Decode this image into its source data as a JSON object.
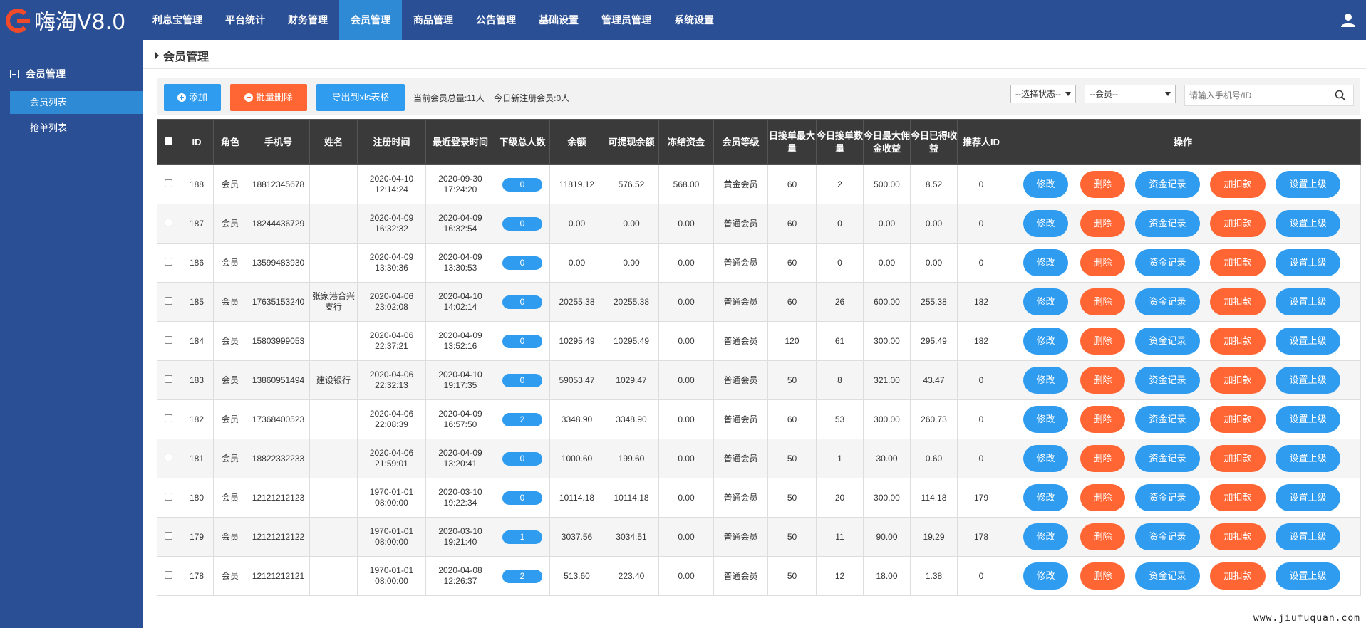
{
  "app": {
    "logo_text": "嗨淘V8.0",
    "nav": [
      "利息宝管理",
      "平台统计",
      "财务管理",
      "会员管理",
      "商品管理",
      "公告管理",
      "基础设置",
      "管理员管理",
      "系统设置"
    ],
    "nav_active": "会员管理"
  },
  "sidebar": {
    "group": "会员管理",
    "items": [
      "会员列表",
      "抢单列表"
    ],
    "active": "会员列表"
  },
  "page": {
    "title": "会员管理"
  },
  "toolbar": {
    "add": "添加",
    "batch_delete": "批量删除",
    "export": "导出到xls表格",
    "total_members": "当前会员总量:11人",
    "today_new": "今日新注册会员:0人",
    "status_select": "--选择状态--",
    "member_select": "--会员--",
    "search_placeholder": "请输入手机号/ID"
  },
  "table": {
    "headers": [
      "ID",
      "角色",
      "手机号",
      "姓名",
      "注册时间",
      "最近登录时间",
      "下级总人数",
      "余额",
      "可提现余额",
      "冻结资金",
      "会员等级",
      "日接单最大量",
      "今日接单数量",
      "今日最大佣金收益",
      "今日已得收益",
      "推荐人ID",
      "操作"
    ],
    "actions": [
      "修改",
      "删除",
      "资金记录",
      "加扣款",
      "设置上级"
    ],
    "rows": [
      {
        "id": "188",
        "role": "会员",
        "phone": "18812345678",
        "name": "",
        "reg": "2020-04-10 12:14:24",
        "login": "2020-09-30 17:24:20",
        "subs": "0",
        "balance": "11819.12",
        "withdrawable": "576.52",
        "frozen": "568.00",
        "level": "黄金会员",
        "daily_max": "60",
        "today_orders": "2",
        "today_max_comm": "500.00",
        "today_earned": "8.52",
        "referrer": "0"
      },
      {
        "id": "187",
        "role": "会员",
        "phone": "18244436729",
        "name": "",
        "reg": "2020-04-09 16:32:32",
        "login": "2020-04-09 16:32:54",
        "subs": "0",
        "balance": "0.00",
        "withdrawable": "0.00",
        "frozen": "0.00",
        "level": "普通会员",
        "daily_max": "60",
        "today_orders": "0",
        "today_max_comm": "0.00",
        "today_earned": "0.00",
        "referrer": "0"
      },
      {
        "id": "186",
        "role": "会员",
        "phone": "13599483930",
        "name": "",
        "reg": "2020-04-09 13:30:36",
        "login": "2020-04-09 13:30:53",
        "subs": "0",
        "balance": "0.00",
        "withdrawable": "0.00",
        "frozen": "0.00",
        "level": "普通会员",
        "daily_max": "60",
        "today_orders": "0",
        "today_max_comm": "0.00",
        "today_earned": "0.00",
        "referrer": "0"
      },
      {
        "id": "185",
        "role": "会员",
        "phone": "17635153240",
        "name": "张家港合兴支行",
        "reg": "2020-04-06 23:02:08",
        "login": "2020-04-10 14:02:14",
        "subs": "0",
        "balance": "20255.38",
        "withdrawable": "20255.38",
        "frozen": "0.00",
        "level": "普通会员",
        "daily_max": "60",
        "today_orders": "26",
        "today_max_comm": "600.00",
        "today_earned": "255.38",
        "referrer": "182"
      },
      {
        "id": "184",
        "role": "会员",
        "phone": "15803999053",
        "name": "",
        "reg": "2020-04-06 22:37:21",
        "login": "2020-04-09 13:52:16",
        "subs": "0",
        "balance": "10295.49",
        "withdrawable": "10295.49",
        "frozen": "0.00",
        "level": "普通会员",
        "daily_max": "120",
        "today_orders": "61",
        "today_max_comm": "300.00",
        "today_earned": "295.49",
        "referrer": "182"
      },
      {
        "id": "183",
        "role": "会员",
        "phone": "13860951494",
        "name": "建设银行",
        "reg": "2020-04-06 22:32:13",
        "login": "2020-04-10 19:17:35",
        "subs": "0",
        "balance": "59053.47",
        "withdrawable": "1029.47",
        "frozen": "0.00",
        "level": "普通会员",
        "daily_max": "50",
        "today_orders": "8",
        "today_max_comm": "321.00",
        "today_earned": "43.47",
        "referrer": "0"
      },
      {
        "id": "182",
        "role": "会员",
        "phone": "17368400523",
        "name": "",
        "reg": "2020-04-06 22:08:39",
        "login": "2020-04-09 16:57:50",
        "subs": "2",
        "balance": "3348.90",
        "withdrawable": "3348.90",
        "frozen": "0.00",
        "level": "普通会员",
        "daily_max": "60",
        "today_orders": "53",
        "today_max_comm": "300.00",
        "today_earned": "260.73",
        "referrer": "0"
      },
      {
        "id": "181",
        "role": "会员",
        "phone": "18822332233",
        "name": "",
        "reg": "2020-04-06 21:59:01",
        "login": "2020-04-09 13:20:41",
        "subs": "0",
        "balance": "1000.60",
        "withdrawable": "199.60",
        "frozen": "0.00",
        "level": "普通会员",
        "daily_max": "50",
        "today_orders": "1",
        "today_max_comm": "30.00",
        "today_earned": "0.60",
        "referrer": "0"
      },
      {
        "id": "180",
        "role": "会员",
        "phone": "12121212123",
        "name": "",
        "reg": "1970-01-01 08:00:00",
        "login": "2020-03-10 19:22:34",
        "subs": "0",
        "balance": "10114.18",
        "withdrawable": "10114.18",
        "frozen": "0.00",
        "level": "普通会员",
        "daily_max": "50",
        "today_orders": "20",
        "today_max_comm": "300.00",
        "today_earned": "114.18",
        "referrer": "179"
      },
      {
        "id": "179",
        "role": "会员",
        "phone": "12121212122",
        "name": "",
        "reg": "1970-01-01 08:00:00",
        "login": "2020-03-10 19:21:40",
        "subs": "1",
        "balance": "3037.56",
        "withdrawable": "3034.51",
        "frozen": "0.00",
        "level": "普通会员",
        "daily_max": "50",
        "today_orders": "11",
        "today_max_comm": "90.00",
        "today_earned": "19.29",
        "referrer": "178"
      },
      {
        "id": "178",
        "role": "会员",
        "phone": "12121212121",
        "name": "",
        "reg": "1970-01-01 08:00:00",
        "login": "2020-04-08 12:26:37",
        "subs": "2",
        "balance": "513.60",
        "withdrawable": "223.40",
        "frozen": "0.00",
        "level": "普通会员",
        "daily_max": "50",
        "today_orders": "12",
        "today_max_comm": "18.00",
        "today_earned": "1.38",
        "referrer": "0"
      }
    ]
  },
  "watermark": "www.jiufuquan.com",
  "colors": {
    "nav_bg": "#2a4f95",
    "active": "#2f8ad6",
    "blue_btn": "#2f9cf0",
    "orange_btn": "#ff6633",
    "table_head": "#3a3a3a"
  }
}
